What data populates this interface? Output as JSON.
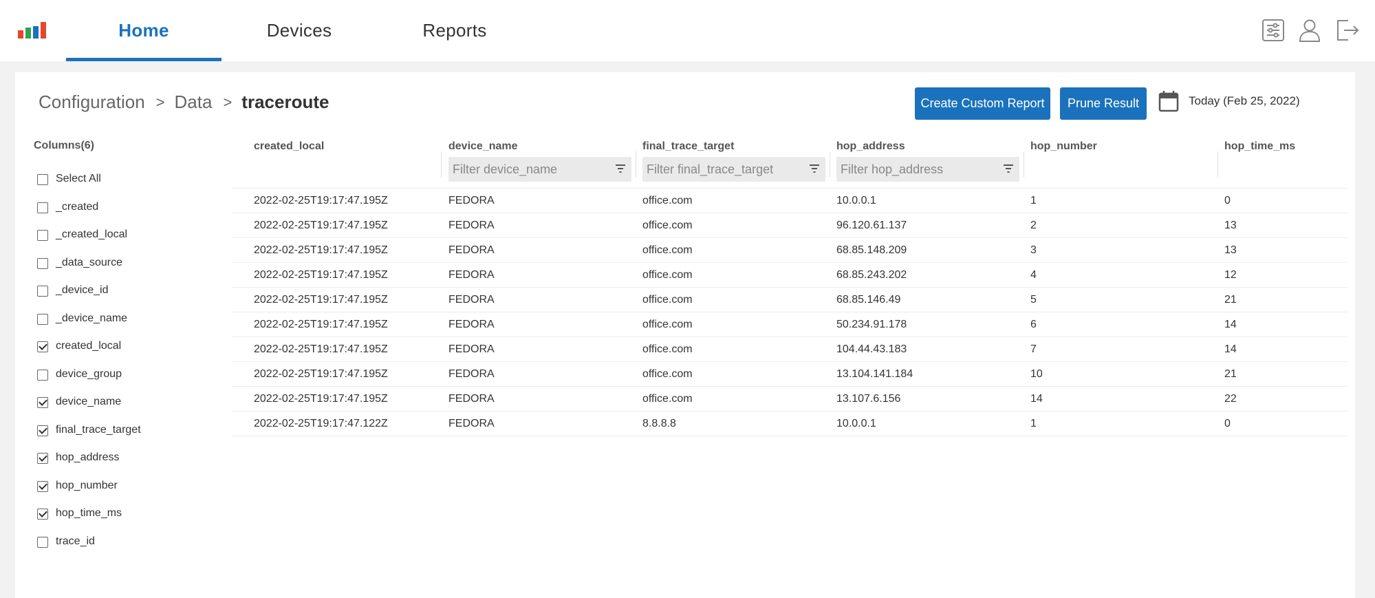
{
  "nav": {
    "tabs": [
      {
        "label": "Home",
        "active": true
      },
      {
        "label": "Devices",
        "active": false
      },
      {
        "label": "Reports",
        "active": false
      }
    ],
    "icons": [
      "settings-sliders-icon",
      "user-icon",
      "logout-icon"
    ],
    "logo_colors": [
      "#e8452c",
      "#2ea44f",
      "#1a72bc",
      "#e8452c"
    ]
  },
  "breadcrumb": {
    "items": [
      "Configuration",
      "Data"
    ],
    "separator": ">",
    "current": "traceroute"
  },
  "toolbar": {
    "create_report_label": "Create Custom Report",
    "prune_label": "Prune Result",
    "date_label": "Today (Feb 25, 2022)"
  },
  "columns_panel": {
    "title": "Columns(6)",
    "items": [
      {
        "label": "Select All",
        "checked": false
      },
      {
        "label": "_created",
        "checked": false
      },
      {
        "label": "_created_local",
        "checked": false
      },
      {
        "label": "_data_source",
        "checked": false
      },
      {
        "label": "_device_id",
        "checked": false
      },
      {
        "label": "_device_name",
        "checked": false
      },
      {
        "label": "created_local",
        "checked": true
      },
      {
        "label": "device_group",
        "checked": false
      },
      {
        "label": "device_name",
        "checked": true
      },
      {
        "label": "final_trace_target",
        "checked": true
      },
      {
        "label": "hop_address",
        "checked": true
      },
      {
        "label": "hop_number",
        "checked": true
      },
      {
        "label": "hop_time_ms",
        "checked": true
      },
      {
        "label": "trace_id",
        "checked": false
      }
    ]
  },
  "table": {
    "headers": [
      "created_local",
      "device_name",
      "final_trace_target",
      "hop_address",
      "hop_number",
      "hop_time_ms"
    ],
    "filters": [
      "",
      "Filter device_name",
      "Filter final_trace_target",
      "Filter hop_address",
      "",
      ""
    ],
    "rows": [
      [
        "2022-02-25T19:17:47.195Z",
        "FEDORA",
        "office.com",
        "10.0.0.1",
        "1",
        "0"
      ],
      [
        "2022-02-25T19:17:47.195Z",
        "FEDORA",
        "office.com",
        "96.120.61.137",
        "2",
        "13"
      ],
      [
        "2022-02-25T19:17:47.195Z",
        "FEDORA",
        "office.com",
        "68.85.148.209",
        "3",
        "13"
      ],
      [
        "2022-02-25T19:17:47.195Z",
        "FEDORA",
        "office.com",
        "68.85.243.202",
        "4",
        "12"
      ],
      [
        "2022-02-25T19:17:47.195Z",
        "FEDORA",
        "office.com",
        "68.85.146.49",
        "5",
        "21"
      ],
      [
        "2022-02-25T19:17:47.195Z",
        "FEDORA",
        "office.com",
        "50.234.91.178",
        "6",
        "14"
      ],
      [
        "2022-02-25T19:17:47.195Z",
        "FEDORA",
        "office.com",
        "104.44.43.183",
        "7",
        "14"
      ],
      [
        "2022-02-25T19:17:47.195Z",
        "FEDORA",
        "office.com",
        "13.104.141.184",
        "10",
        "21"
      ],
      [
        "2022-02-25T19:17:47.195Z",
        "FEDORA",
        "office.com",
        "13.107.6.156",
        "14",
        "22"
      ],
      [
        "2022-02-25T19:17:47.122Z",
        "FEDORA",
        "8.8.8.8",
        "10.0.0.1",
        "1",
        "0"
      ]
    ]
  }
}
